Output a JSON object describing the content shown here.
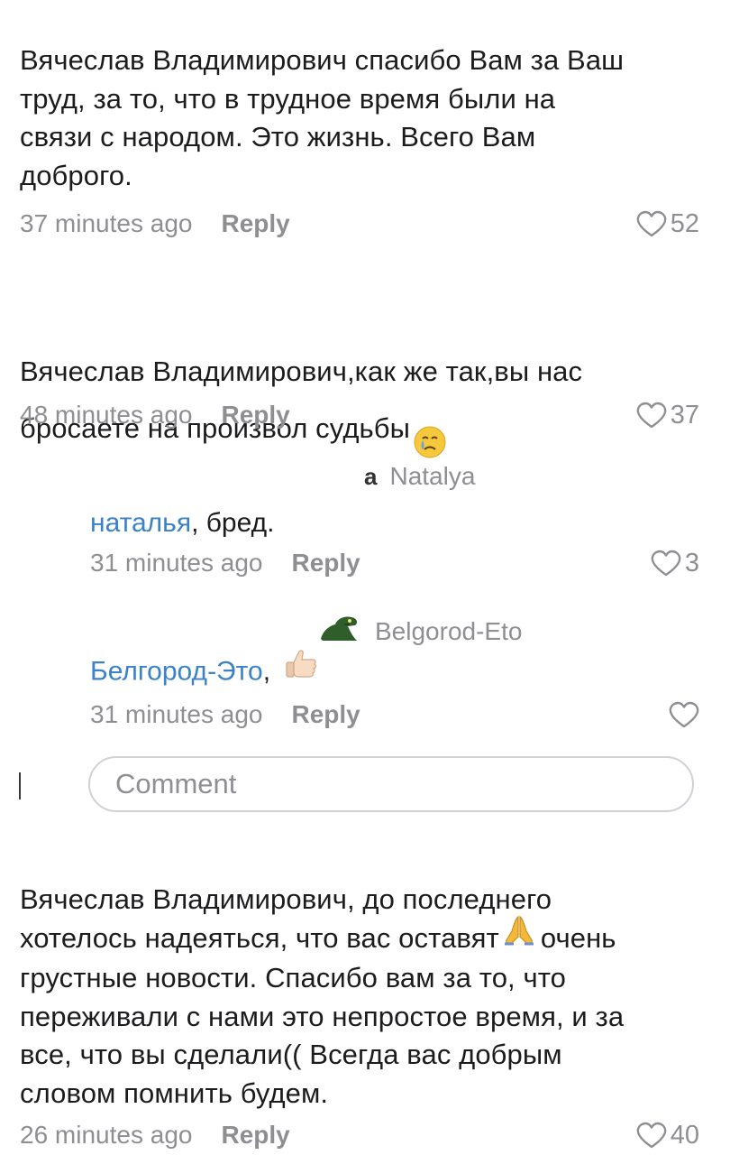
{
  "comments": [
    {
      "text": "Вячеслав Владимирович спасибо Вам за Ваш\nтруд, за то, что в трудное время были на\nсвязи с народом. Это жизнь. Всего Вам\nдоброго.",
      "time": "37 minutes ago",
      "reply_label": "Reply",
      "likes": "52"
    },
    {
      "text": "Вячеслав Владимирович,как же так,вы нас\nбросаете на произвол судьбы",
      "emoji": "crying-face",
      "time": "48 minutes ago",
      "reply_label": "Reply",
      "likes": "37"
    },
    {
      "text_lines": [
        "Вячеслав Владимирович, до последнего",
        "хотелось надеяться, что вас оставят",
        "очень",
        "грустные новости. Спасибо вам за то, что",
        "переживали с нами это непростое время, и за",
        "все, что вы сделали(( Всегда вас добрым",
        "словом помнить будем."
      ],
      "emoji": "folded-hands",
      "time": "26 minutes ago",
      "reply_label": "Reply",
      "likes": "40"
    }
  ],
  "replies": [
    {
      "avatar_letter": "a",
      "author": "Natalya",
      "mention": "наталья",
      "text": ", бред.",
      "time": "31 minutes ago",
      "reply_label": "Reply",
      "likes": "3"
    },
    {
      "avatar": "dinosaur-avatar",
      "author": "Belgorod-Eto",
      "mention": "Белгород-Это",
      "text": ",",
      "emoji": "thumbs-up",
      "time": "31 minutes ago",
      "reply_label": "Reply",
      "likes": ""
    }
  ],
  "comment_input": {
    "placeholder": "Comment"
  },
  "colors": {
    "text": "#1c1c1e",
    "meta": "#8e8e93",
    "mention": "#3b82c6",
    "border": "#d1d1d6"
  }
}
